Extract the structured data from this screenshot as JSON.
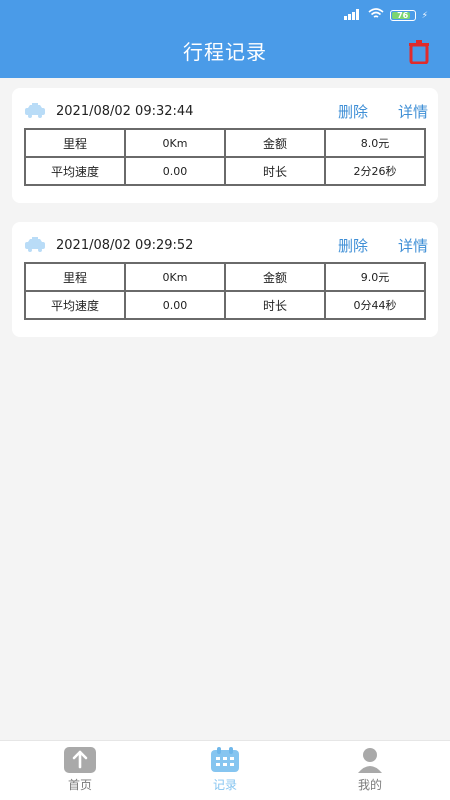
{
  "status": {
    "battery": "76"
  },
  "header": {
    "title": "行程记录"
  },
  "trips": [
    {
      "datetime": "2021/08/02 09:32:44",
      "delete_label": "删除",
      "details_label": "详情",
      "row1": {
        "k1": "里程",
        "v1": "0Km",
        "k2": "金额",
        "v2": "8.0元"
      },
      "row2": {
        "k1": "平均速度",
        "v1": "0.00",
        "k2": "时长",
        "v2": "2分26秒"
      }
    },
    {
      "datetime": "2021/08/02 09:29:52",
      "delete_label": "删除",
      "details_label": "详情",
      "row1": {
        "k1": "里程",
        "v1": "0Km",
        "k2": "金额",
        "v2": "9.0元"
      },
      "row2": {
        "k1": "平均速度",
        "v1": "0.00",
        "k2": "时长",
        "v2": "0分44秒"
      }
    }
  ],
  "tabs": [
    {
      "label": "首页",
      "icon": "upload-icon"
    },
    {
      "label": "记录",
      "icon": "calendar-icon"
    },
    {
      "label": "我的",
      "icon": "user-icon"
    }
  ],
  "colors": {
    "primary": "#4a9be8",
    "accent": "#3f8fd6",
    "trash": "#e02b2b",
    "tab_active": "#86c5f0"
  }
}
